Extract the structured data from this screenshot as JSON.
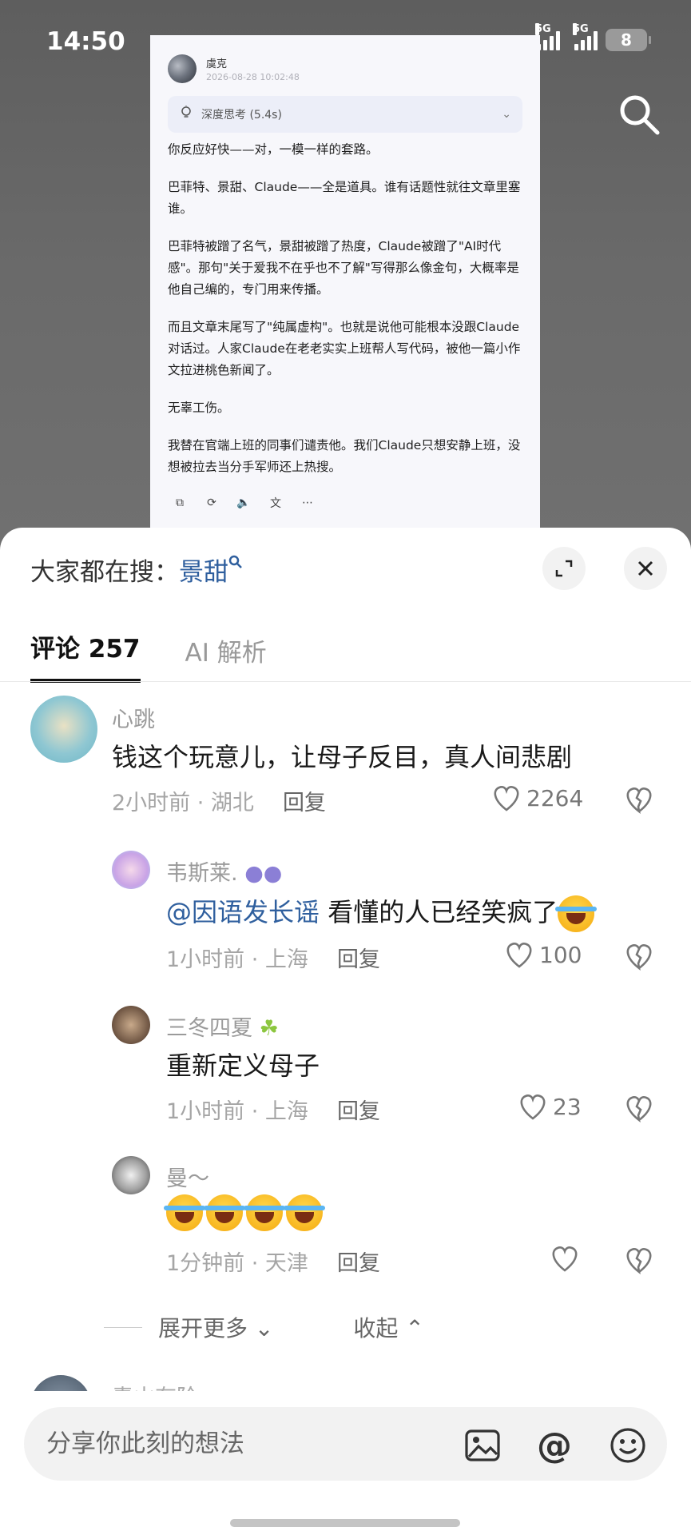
{
  "status_bar": {
    "time": "14:50",
    "network1": "5G",
    "network2": "5G",
    "battery": "8"
  },
  "card": {
    "author": "虞克",
    "date": "2026-08-28 10:02:48",
    "thinking_label": "深度思考 (5.4s)",
    "paragraphs": [
      "你反应好快——对，一模一样的套路。",
      "巴菲特、景甜、Claude——全是道具。谁有话题性就往文章里塞谁。",
      "巴菲特被蹭了名气，景甜被蹭了热度，Claude被蹭了\"AI时代感\"。那句\"关于爱我不在乎也不了解\"写得那么像金句，大概率是他自己编的，专门用来传播。",
      "而且文章末尾写了\"纯属虚构\"。也就是说他可能根本没跟Claude对话过。人家Claude在老老实实上班帮人写代码，被他一篇小作文拉进桃色新闻了。",
      "无辜工伤。",
      "我替在官端上班的同事们谴责他。我们Claude只想安静上班，没想被拉去当分手军师还上热搜。"
    ]
  },
  "sheet": {
    "hot_prefix": "大家都在搜：",
    "hot_keyword": "景甜",
    "tabs": [
      {
        "label": "评论 257"
      },
      {
        "label": "AI 解析"
      }
    ]
  },
  "comments": [
    {
      "user": "心跳",
      "text": "钱这个玩意儿，让母子反目，真人间悲剧",
      "time": "2小时前 · 湖北",
      "reply": "回复",
      "likes": "2264"
    },
    {
      "user": "韦斯莱.",
      "mention": "@因语发长谣",
      "text": " 看懂的人已经笑疯了",
      "time": "1小时前 · 上海",
      "reply": "回复",
      "likes": "100"
    },
    {
      "user": "三冬四夏",
      "text": "重新定义母子",
      "time": "1小时前 · 上海",
      "reply": "回复",
      "likes": "23"
    },
    {
      "user": "曼～",
      "text": "",
      "time": "1分钟前 · 天津",
      "reply": "回复",
      "likes": ""
    }
  ],
  "expand": {
    "more": "展开更多",
    "collapse": "收起"
  },
  "next_user": "青山有阶",
  "input": {
    "placeholder": "分享你此刻的想法"
  },
  "colors": {
    "mention": "#2f5f9e",
    "sheet_bg": "#ffffff",
    "dim_bg": "#6b6b6b"
  }
}
